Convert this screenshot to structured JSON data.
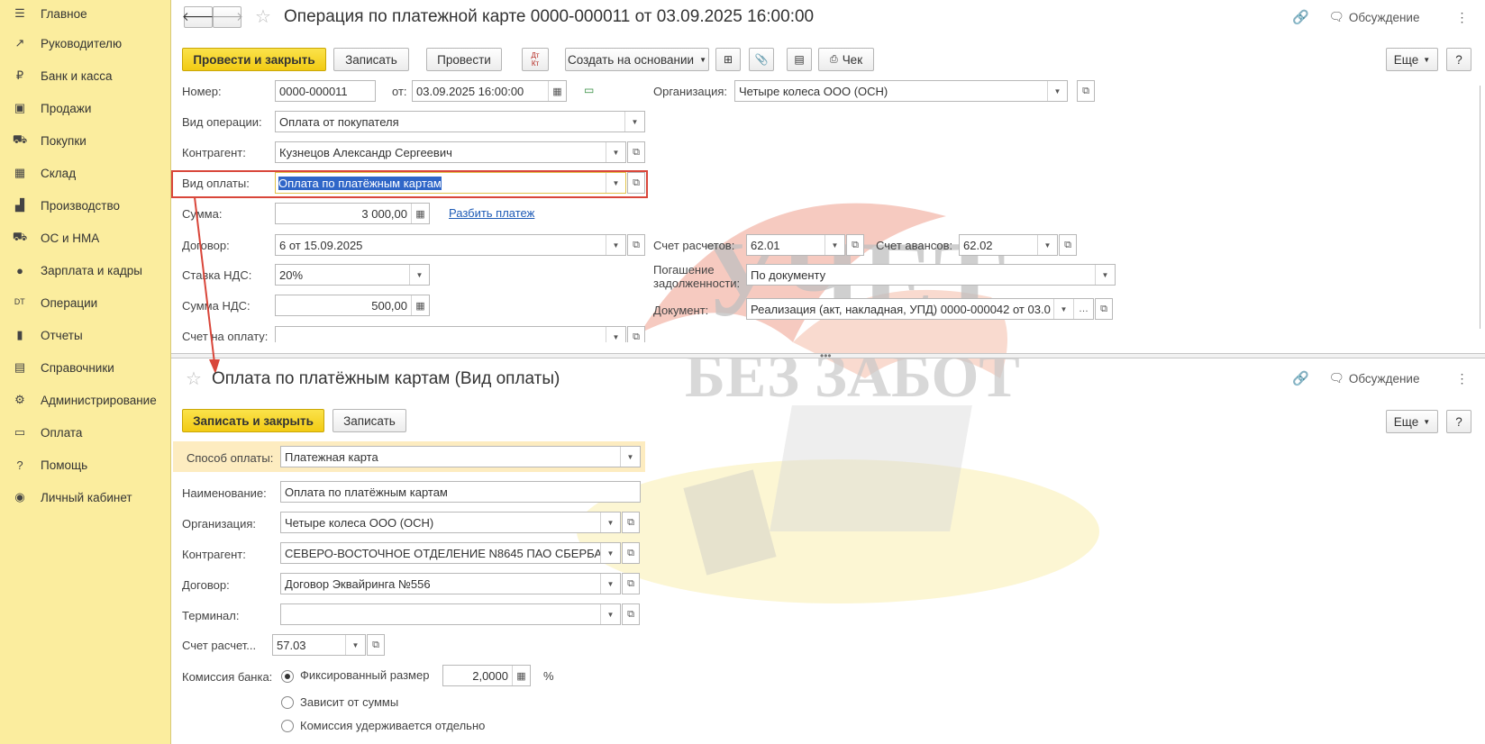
{
  "sidebar": {
    "items": [
      {
        "icon": "menu-icon",
        "glyph": "☰",
        "label": "Главное"
      },
      {
        "icon": "chart-trend-icon",
        "glyph": "↗",
        "label": "Руководителю"
      },
      {
        "icon": "ruble-icon",
        "glyph": "₽",
        "label": "Банк и касса"
      },
      {
        "icon": "shopping-bag-icon",
        "glyph": "▣",
        "label": "Продажи"
      },
      {
        "icon": "cart-icon",
        "glyph": "⛟",
        "label": "Покупки"
      },
      {
        "icon": "warehouse-icon",
        "glyph": "▦",
        "label": "Склад"
      },
      {
        "icon": "factory-icon",
        "glyph": "▟",
        "label": "Производство"
      },
      {
        "icon": "truck-icon",
        "glyph": "⛟",
        "label": "ОС и НМА"
      },
      {
        "icon": "person-icon",
        "glyph": "●",
        "label": "Зарплата и кадры"
      },
      {
        "icon": "dt-kt-icon",
        "glyph": "ᴰᵀ",
        "label": "Операции"
      },
      {
        "icon": "bar-chart-icon",
        "glyph": "▮",
        "label": "Отчеты"
      },
      {
        "icon": "book-icon",
        "glyph": "▤",
        "label": "Справочники"
      },
      {
        "icon": "gear-icon",
        "glyph": "⚙",
        "label": "Администрирование"
      },
      {
        "icon": "payment-icon",
        "glyph": "▭",
        "label": "Оплата"
      },
      {
        "icon": "question-icon",
        "glyph": "?",
        "label": "Помощь"
      },
      {
        "icon": "account-icon",
        "glyph": "◉",
        "label": "Личный кабинет"
      }
    ]
  },
  "top": {
    "title": "Операция по платежной карте 0000-000011 от 03.09.2025 16:00:00",
    "discussion": "Обсуждение",
    "buttons": {
      "post_close": "Провести и закрыть",
      "save": "Записать",
      "post": "Провести",
      "dtkt": "Дт Кт",
      "create_based": "Создать на основании",
      "check": "Чек",
      "more": "Еще",
      "help": "?"
    },
    "fields": {
      "number_label": "Номер:",
      "number": "0000-000011",
      "from_label": "от:",
      "date": "03.09.2025 16:00:00",
      "org_label": "Организация:",
      "org": "Четыре колеса ООО (ОСН)",
      "optype_label": "Вид операции:",
      "optype": "Оплата от покупателя",
      "contractor_label": "Контрагент:",
      "contractor": "Кузнецов Александр Сергеевич",
      "paytype_label": "Вид оплаты:",
      "paytype": "Оплата по платёжным картам",
      "sum_label": "Сумма:",
      "sum": "3 000,00",
      "split_link": "Разбить платеж",
      "contract_label": "Договор:",
      "contract": "6 от 15.09.2025",
      "acc_label": "Счет расчетов:",
      "acc": "62.01",
      "adv_label": "Счет авансов:",
      "adv": "62.02",
      "vat_label": "Ставка НДС:",
      "vat": "20%",
      "repay_label_1": "Погашение",
      "repay_label_2": "задолженности:",
      "repay": "По документу",
      "vatsum_label": "Сумма НДС:",
      "vatsum": "500,00",
      "doc_label": "Документ:",
      "doc": "Реализация (акт, накладная, УПД) 0000-000042 от 03.0",
      "invoice_label": "Счет на оплату:"
    }
  },
  "bottom": {
    "title": "Оплата по платёжным картам (Вид оплаты)",
    "discussion": "Обсуждение",
    "buttons": {
      "save_close": "Записать и закрыть",
      "save": "Записать",
      "more": "Еще",
      "help": "?"
    },
    "fields": {
      "method_label": "Способ оплаты:",
      "method": "Платежная карта",
      "name_label": "Наименование:",
      "name": "Оплата по платёжным картам",
      "org_label": "Организация:",
      "org": "Четыре колеса ООО (ОСН)",
      "contractor_label": "Контрагент:",
      "contractor": "СЕВЕРО-ВОСТОЧНОЕ ОТДЕЛЕНИЕ N8645 ПАО СБЕРБА",
      "contract_label": "Договор:",
      "contract": "Договор Эквайринга №556",
      "terminal_label": "Терминал:",
      "terminal": "",
      "acc_label": "Счет расчет...",
      "acc": "57.03",
      "commission_label": "Комиссия банка:",
      "opt_fixed": "Фиксированный размер",
      "fixed_value": "2,0000",
      "percent": "%",
      "opt_sum": "Зависит от суммы",
      "opt_separate": "Комиссия удерживается отдельно"
    }
  },
  "watermark": {
    "line1": "УЧЕТ",
    "line2": "БЕЗ ЗАБОТ"
  },
  "colors": {
    "sidebar_bg": "#fbed9e",
    "primary_button": "#f6d428",
    "highlight_red": "#d9463a",
    "link_blue": "#1e5bb6",
    "selection_blue": "#2f66c8"
  }
}
